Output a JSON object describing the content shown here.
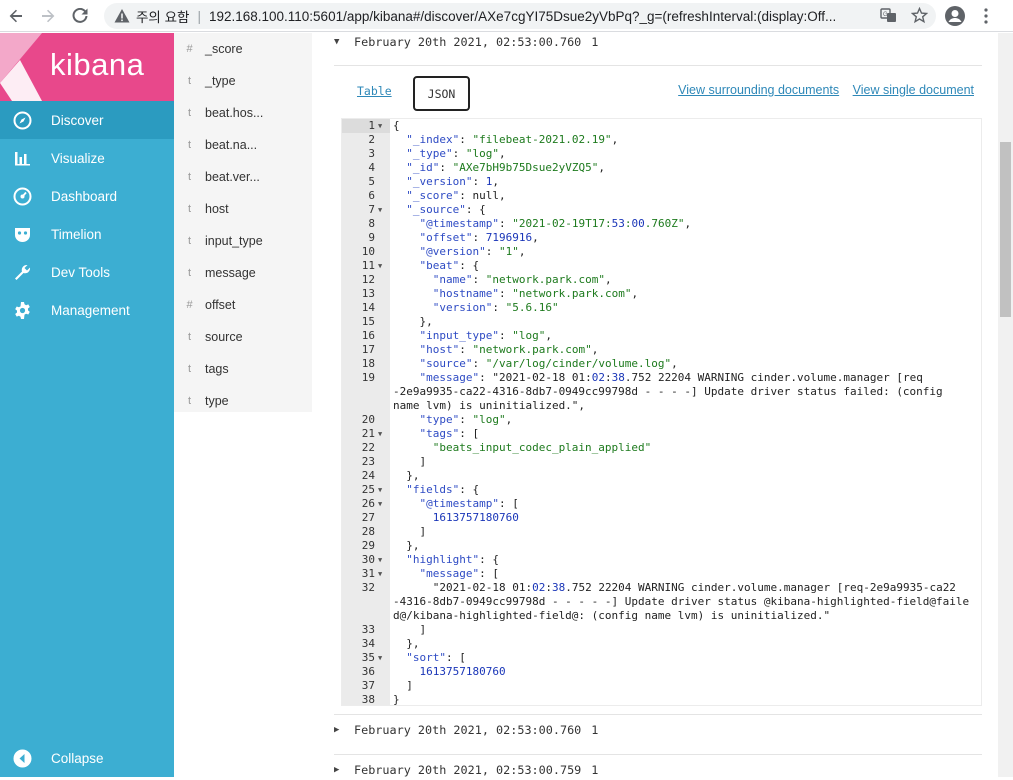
{
  "browser": {
    "security_label": "주의 요함",
    "url": "192.168.100.110:5601/app/kibana#/discover/AXe7cgYI75Dsue2yVbPq?_g=(refreshInterval:(display:Off..."
  },
  "sidebar": {
    "brand": "kibana",
    "items": [
      {
        "label": "Discover",
        "icon": "compass-icon",
        "active": true
      },
      {
        "label": "Visualize",
        "icon": "bar-chart-icon",
        "active": false
      },
      {
        "label": "Dashboard",
        "icon": "dashboard-gauge-icon",
        "active": false
      },
      {
        "label": "Timelion",
        "icon": "timelion-mask-icon",
        "active": false
      },
      {
        "label": "Dev Tools",
        "icon": "wrench-icon",
        "active": false
      },
      {
        "label": "Management",
        "icon": "gear-icon",
        "active": false
      }
    ],
    "collapse_label": "Collapse"
  },
  "fields": [
    {
      "type": "#",
      "name": "_score"
    },
    {
      "type": "t",
      "name": "_type"
    },
    {
      "type": "t",
      "name": "beat.hos..."
    },
    {
      "type": "t",
      "name": "beat.na..."
    },
    {
      "type": "t",
      "name": "beat.ver..."
    },
    {
      "type": "t",
      "name": "host"
    },
    {
      "type": "t",
      "name": "input_type"
    },
    {
      "type": "t",
      "name": "message"
    },
    {
      "type": "#",
      "name": "offset"
    },
    {
      "type": "t",
      "name": "source"
    },
    {
      "type": "t",
      "name": "tags"
    },
    {
      "type": "t",
      "name": "type"
    }
  ],
  "documents": {
    "expanded": {
      "time": "February 20th 2021, 02:53:00.760",
      "count": "1"
    },
    "tabs": {
      "table": "Table",
      "json": "JSON"
    },
    "links": {
      "surrounding": "View surrounding documents",
      "single": "View single document"
    },
    "collapsed": [
      {
        "time": "February 20th 2021, 02:53:00.760",
        "count": "1"
      },
      {
        "time": "February 20th 2021, 02:53:00.759",
        "count": "1"
      }
    ]
  },
  "json_lines": [
    {
      "n": "1",
      "fold": true,
      "t": "{"
    },
    {
      "n": "2",
      "t": "  \"_index\": \"filebeat-2021.02.19\","
    },
    {
      "n": "3",
      "t": "  \"_type\": \"log\","
    },
    {
      "n": "4",
      "t": "  \"_id\": \"AXe7bH9b75Dsue2yVZQ5\","
    },
    {
      "n": "5",
      "t": "  \"_version\": 1,"
    },
    {
      "n": "6",
      "t": "  \"_score\": null,"
    },
    {
      "n": "7",
      "fold": true,
      "t": "  \"_source\": {"
    },
    {
      "n": "8",
      "t": "    \"@timestamp\": \"2021-02-19T17:53:00.760Z\","
    },
    {
      "n": "9",
      "t": "    \"offset\": 7196916,"
    },
    {
      "n": "10",
      "t": "    \"@version\": \"1\","
    },
    {
      "n": "11",
      "fold": true,
      "t": "    \"beat\": {"
    },
    {
      "n": "12",
      "t": "      \"name\": \"network.park.com\","
    },
    {
      "n": "13",
      "t": "      \"hostname\": \"network.park.com\","
    },
    {
      "n": "14",
      "t": "      \"version\": \"5.6.16\""
    },
    {
      "n": "15",
      "t": "    },"
    },
    {
      "n": "16",
      "t": "    \"input_type\": \"log\","
    },
    {
      "n": "17",
      "t": "    \"host\": \"network.park.com\","
    },
    {
      "n": "18",
      "t": "    \"source\": \"/var/log/cinder/volume.log\","
    },
    {
      "n": "19",
      "t": "    \"message\": \"2021-02-18 01:02:38.752 22204 WARNING cinder.volume.manager [req"
    },
    {
      "n": "",
      "t": "-2e9a9935-ca22-4316-8db7-0949cc99798d - - - -] Update driver status failed: (config"
    },
    {
      "n": "",
      "t": "name lvm) is uninitialized.\","
    },
    {
      "n": "20",
      "t": "    \"type\": \"log\","
    },
    {
      "n": "21",
      "fold": true,
      "t": "    \"tags\": ["
    },
    {
      "n": "22",
      "t": "      \"beats_input_codec_plain_applied\""
    },
    {
      "n": "23",
      "t": "    ]"
    },
    {
      "n": "24",
      "t": "  },"
    },
    {
      "n": "25",
      "fold": true,
      "t": "  \"fields\": {"
    },
    {
      "n": "26",
      "fold": true,
      "t": "    \"@timestamp\": ["
    },
    {
      "n": "27",
      "t": "      1613757180760"
    },
    {
      "n": "28",
      "t": "    ]"
    },
    {
      "n": "29",
      "t": "  },"
    },
    {
      "n": "30",
      "fold": true,
      "t": "  \"highlight\": {"
    },
    {
      "n": "31",
      "fold": true,
      "t": "    \"message\": ["
    },
    {
      "n": "32",
      "t": "      \"2021-02-18 01:02:38.752 22204 WARNING cinder.volume.manager [req-2e9a9935-ca22"
    },
    {
      "n": "",
      "t": "-4316-8db7-0949cc99798d - - - - -] Update driver status @kibana-highlighted-field@faile"
    },
    {
      "n": "",
      "t": "d@/kibana-highlighted-field@: (config name lvm) is uninitialized.\""
    },
    {
      "n": "33",
      "t": "    ]"
    },
    {
      "n": "34",
      "t": "  },"
    },
    {
      "n": "35",
      "fold": true,
      "t": "  \"sort\": ["
    },
    {
      "n": "36",
      "t": "    1613757180760"
    },
    {
      "n": "37",
      "t": "  ]"
    },
    {
      "n": "38",
      "t": "}"
    }
  ]
}
